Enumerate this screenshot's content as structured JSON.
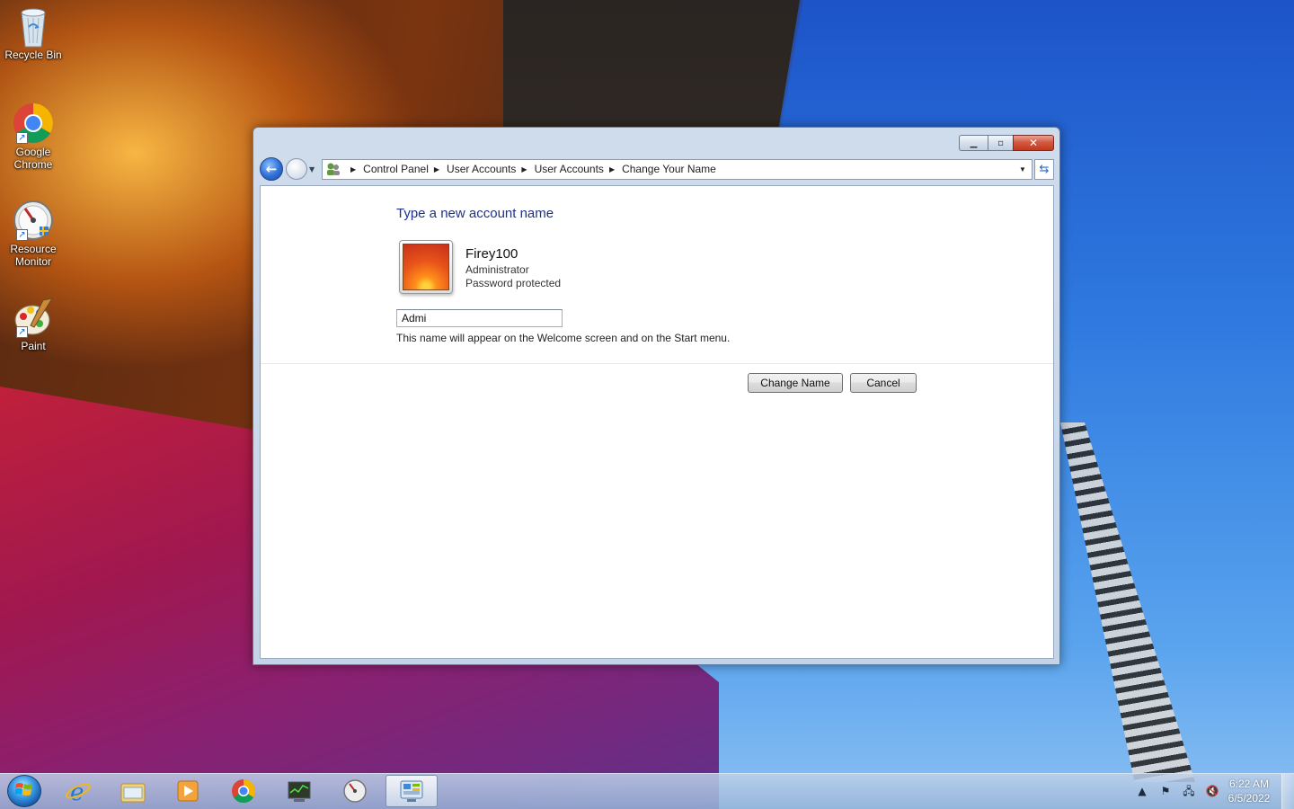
{
  "desktop": {
    "icons": [
      {
        "label": "Recycle Bin",
        "icon": "recycle-bin-icon"
      },
      {
        "label": "Google Chrome",
        "icon": "chrome-icon"
      },
      {
        "label": "Resource Monitor",
        "icon": "resource-monitor-icon"
      },
      {
        "label": "Paint",
        "icon": "paint-icon"
      }
    ]
  },
  "window": {
    "caption_buttons": {
      "minimize": "minimize-icon",
      "maximize": "maximize-icon",
      "close": "close-icon"
    },
    "breadcrumbs": [
      "Control Panel",
      "User Accounts",
      "User Accounts",
      "Change Your Name"
    ]
  },
  "content": {
    "heading": "Type a new account name",
    "account": {
      "name": "Firey100",
      "role": "Administrator",
      "status": "Password protected"
    },
    "name_input_value": "Admi",
    "hint": "This name will appear on the Welcome screen and on the Start menu.",
    "change_button": "Change Name",
    "cancel_button": "Cancel"
  },
  "taskbar": {
    "pinned": [
      {
        "icon": "internet-explorer-icon"
      },
      {
        "icon": "windows-explorer-icon"
      },
      {
        "icon": "media-player-icon"
      },
      {
        "icon": "chrome-icon"
      },
      {
        "icon": "task-manager-icon"
      },
      {
        "icon": "resource-monitor-icon"
      },
      {
        "icon": "control-panel-icon",
        "active": true
      }
    ],
    "clock": {
      "time": "6:22 AM",
      "date": "6/5/2022"
    }
  },
  "colors": {
    "heading": "#1e3287",
    "close_button": "#c2391f",
    "window_frame": "#c4d4e8"
  }
}
